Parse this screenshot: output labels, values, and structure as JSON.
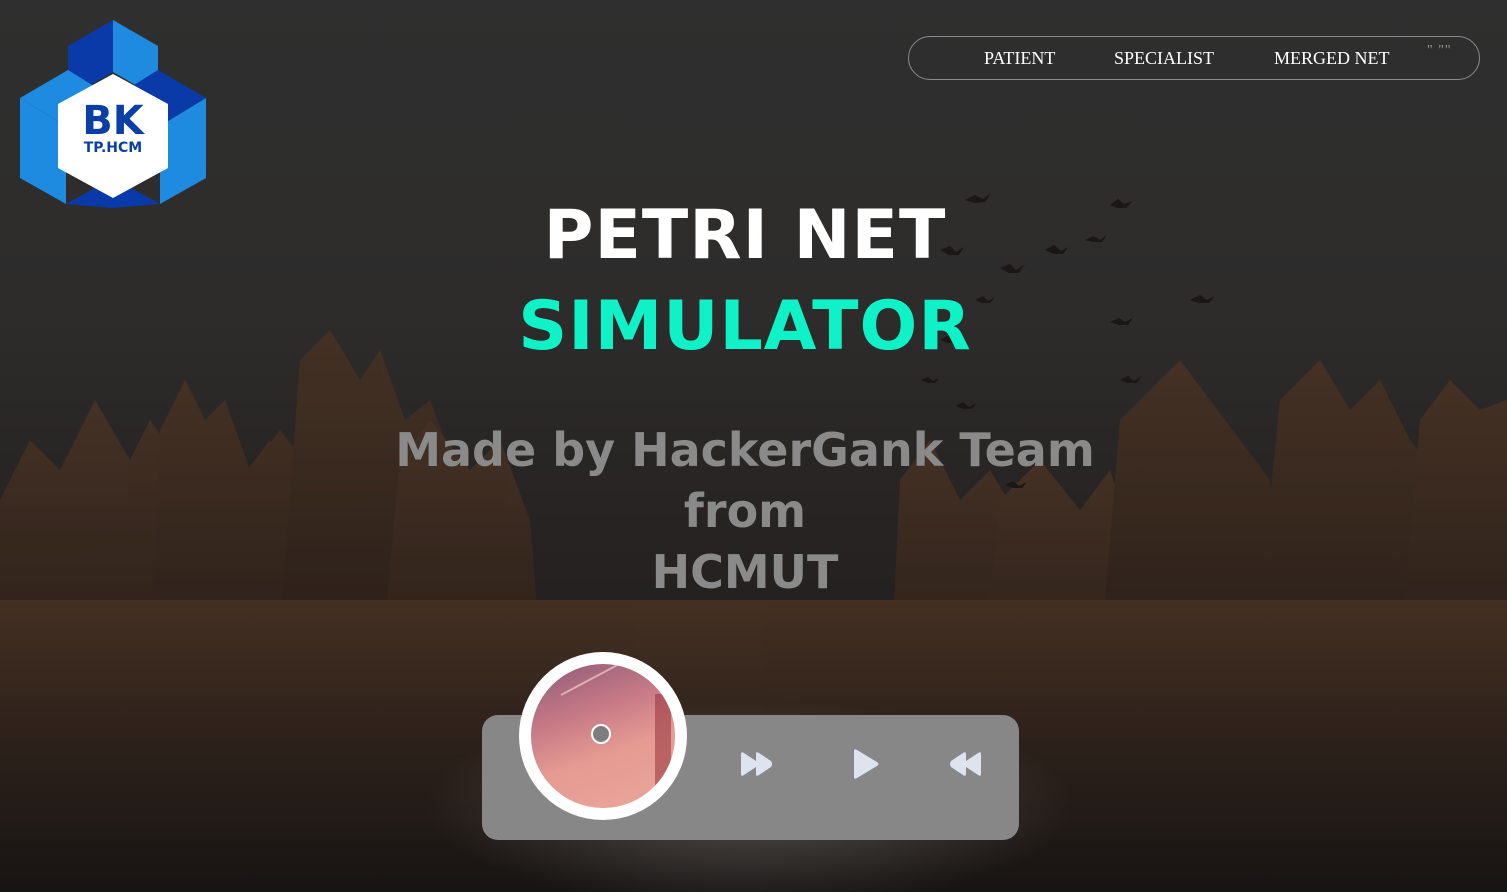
{
  "logo": {
    "line1": "BK",
    "line2": "TP.HCM",
    "colors": {
      "dark_blue": "#0a3aa8",
      "light_blue": "#1e8ae0",
      "text": "#0b3fa6"
    }
  },
  "nav": {
    "items": [
      {
        "label": "PATIENT"
      },
      {
        "label": "SPECIALIST"
      },
      {
        "label": "MERGED NET"
      }
    ],
    "extra": "\" \"\""
  },
  "hero": {
    "title_line1": "PETRI NET",
    "title_line2": "SIMULATOR",
    "subtitle_line1": "Made by HackerGank Team from",
    "subtitle_line2": "HCMUT",
    "accent_color": "#0ff2c8"
  },
  "player": {
    "controls": [
      {
        "name": "fast-forward-icon"
      },
      {
        "name": "play-icon"
      },
      {
        "name": "rewind-icon"
      }
    ]
  }
}
